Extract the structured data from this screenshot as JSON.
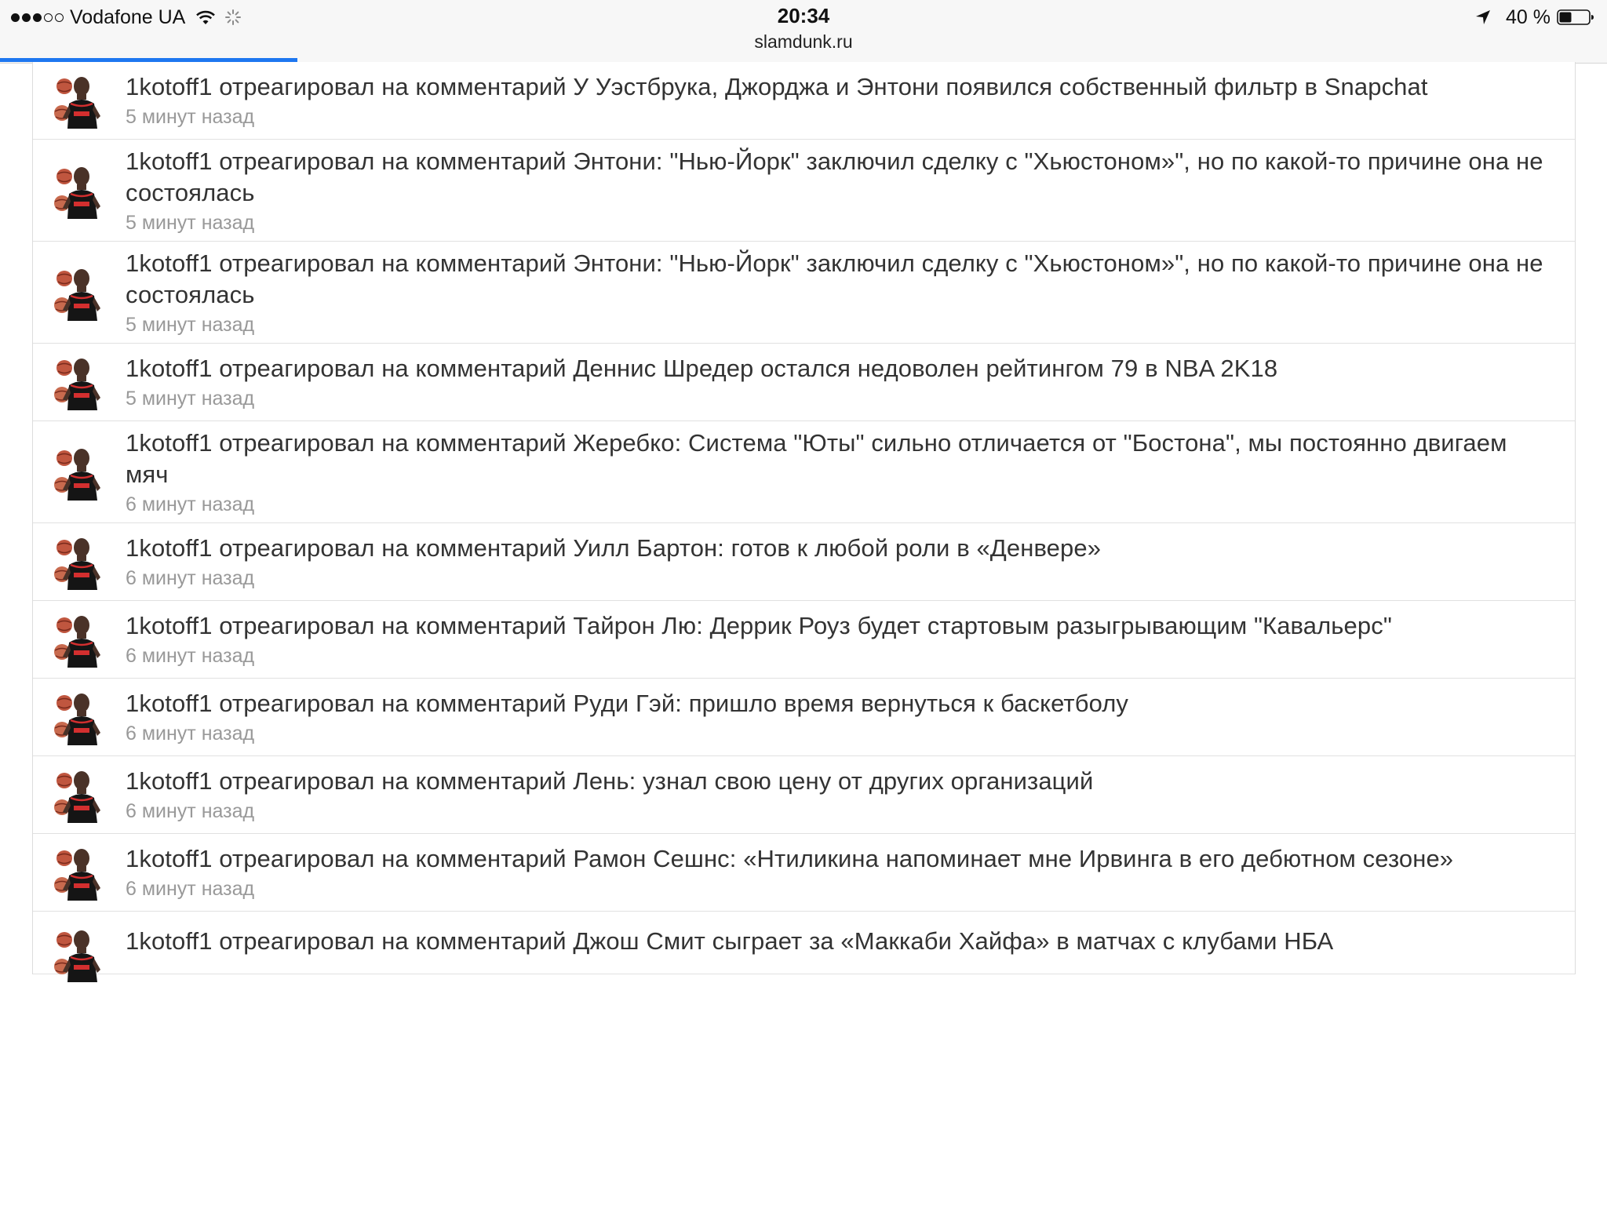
{
  "status_bar": {
    "carrier": "Vodafone UA",
    "time": "20:34",
    "url": "slamdunk.ru",
    "battery": "40 %",
    "signal_bars": 3,
    "signal_total": 5
  },
  "page_load_progress": 0.185,
  "colors": {
    "progress": "#1e77f0",
    "text": "#333333",
    "timestamp": "#999999"
  },
  "feed": {
    "items": [
      {
        "text": "1kotoff1 отреагировал на комментарий У Уэстбрука, Джорджа и Энтони появился собственный фильтр в Snapchat",
        "time": "5 минут назад"
      },
      {
        "text": "1kotoff1 отреагировал на комментарий Энтони: \"Нью-Йорк\" заключил сделку с \"Хьюстоном»\", но по какой-то причине она не состоялась",
        "time": "5 минут назад"
      },
      {
        "text": "1kotoff1 отреагировал на комментарий Энтони: \"Нью-Йорк\" заключил сделку с \"Хьюстоном»\", но по какой-то причине она не состоялась",
        "time": "5 минут назад"
      },
      {
        "text": "1kotoff1 отреагировал на комментарий Деннис Шредер остался недоволен рейтингом 79 в NBA 2K18",
        "time": "5 минут назад"
      },
      {
        "text": "1kotoff1 отреагировал на комментарий Жеребко: Система \"Юты\" сильно отличается от \"Бостона\", мы постоянно двигаем мяч",
        "time": "6 минут назад"
      },
      {
        "text": "1kotoff1 отреагировал на комментарий Уилл Бартон: готов к любой роли в «Денвере»",
        "time": "6 минут назад"
      },
      {
        "text": "1kotoff1 отреагировал на комментарий Тайрон Лю: Деррик Роуз будет стартовым разыгрывающим \"Кавальерс\"",
        "time": "6 минут назад"
      },
      {
        "text": "1kotoff1 отреагировал на комментарий Руди Гэй: пришло время вернуться к баскетболу",
        "time": "6 минут назад"
      },
      {
        "text": "1kotoff1 отреагировал на комментарий Лень: узнал свою цену от других организаций",
        "time": "6 минут назад"
      },
      {
        "text": "1kotoff1 отреагировал на комментарий Рамон Сешнс: «Нтиликина напоминает мне Ирвинга в его дебютном сезоне»",
        "time": "6 минут назад"
      },
      {
        "text": "1kotoff1 отреагировал на комментарий Джош Смит сыграет за «Маккаби Хайфа» в матчах с клубами НБА",
        "time": ""
      }
    ]
  }
}
